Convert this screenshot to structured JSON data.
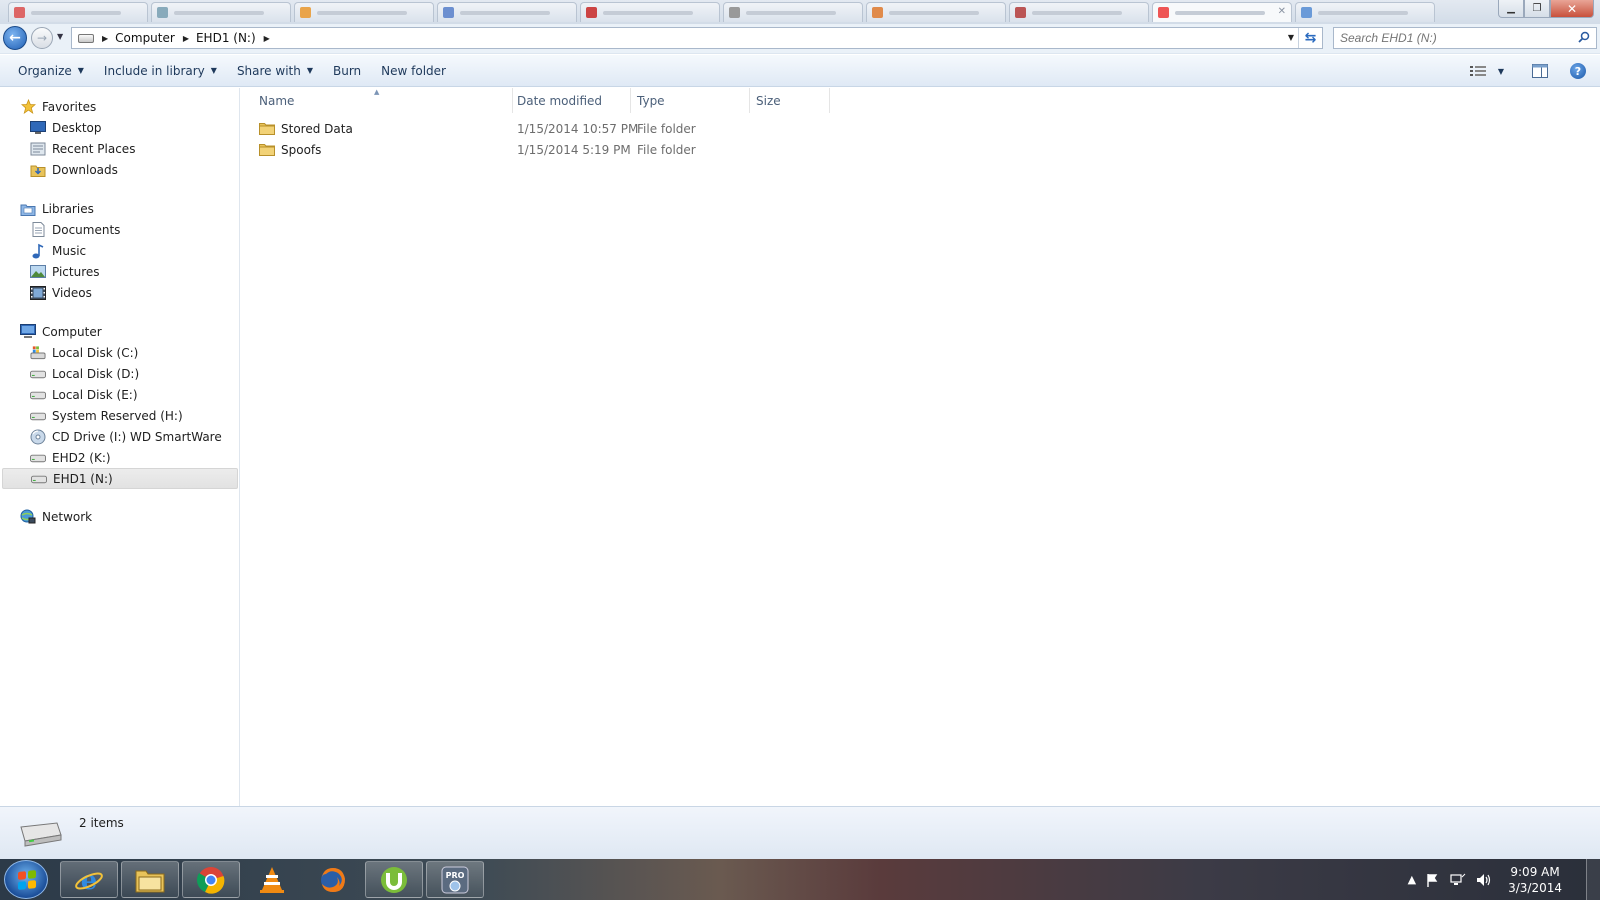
{
  "address": {
    "crumbs": [
      "Computer",
      "EHD1 (N:)"
    ]
  },
  "search": {
    "placeholder": "Search EHD1 (N:)"
  },
  "toolbar": {
    "organize": "Organize",
    "include_in_library": "Include in library",
    "share_with": "Share with",
    "burn": "Burn",
    "new_folder": "New folder"
  },
  "nav": {
    "favorites": {
      "label": "Favorites",
      "items": [
        "Desktop",
        "Recent Places",
        "Downloads"
      ]
    },
    "libraries": {
      "label": "Libraries",
      "items": [
        "Documents",
        "Music",
        "Pictures",
        "Videos"
      ]
    },
    "computer": {
      "label": "Computer",
      "items": [
        "Local Disk (C:)",
        "Local Disk (D:)",
        "Local Disk (E:)",
        "System Reserved (H:)",
        "CD Drive (I:) WD SmartWare",
        "EHD2 (K:)",
        "EHD1 (N:)"
      ],
      "selected": "EHD1 (N:)"
    },
    "network": {
      "label": "Network"
    }
  },
  "columns": {
    "name": "Name",
    "date_modified": "Date modified",
    "type": "Type",
    "size": "Size"
  },
  "files": [
    {
      "name": "Stored Data",
      "date_modified": "1/15/2014 10:57 PM",
      "type": "File folder",
      "size": ""
    },
    {
      "name": "Spoofs",
      "date_modified": "1/15/2014 5:19 PM",
      "type": "File folder",
      "size": ""
    }
  ],
  "status": {
    "item_count": "2 items"
  },
  "taskbar": {
    "apps": [
      "internet-explorer",
      "windows-explorer",
      "chrome",
      "vlc",
      "firefox",
      "utorrent",
      "pro-dvd"
    ],
    "time": "9:09 AM",
    "date": "3/3/2014"
  },
  "colors": {
    "accent": "#1e395b",
    "header_text": "#4c607a",
    "muted_text": "#6d6d6d",
    "folder": "#e8c35a"
  }
}
